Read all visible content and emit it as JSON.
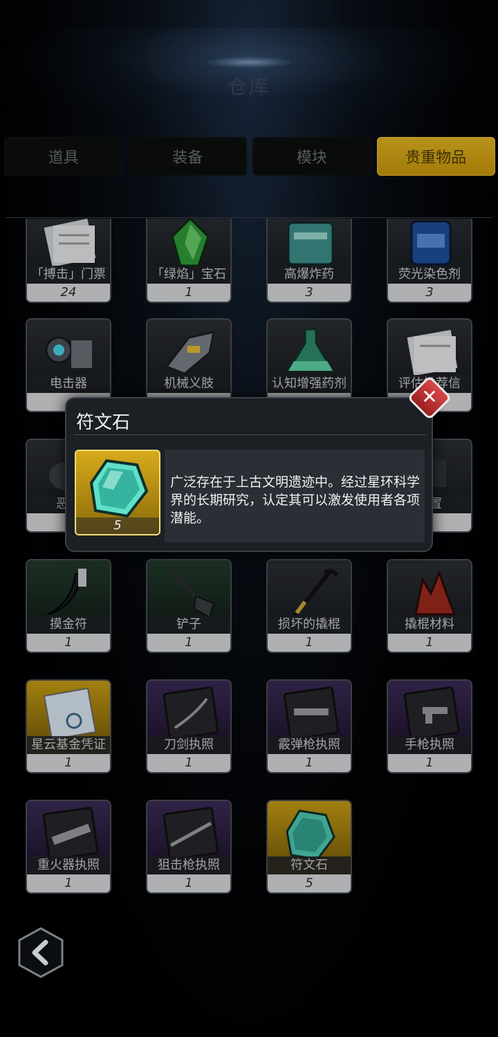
{
  "title": "仓库",
  "tabs": [
    {
      "label": "道具",
      "active": false
    },
    {
      "label": "装备",
      "active": false
    },
    {
      "label": "模块",
      "active": false
    },
    {
      "label": "贵重物品",
      "active": true
    }
  ],
  "items": [
    {
      "name": "「搏击」门票",
      "count": "24",
      "tone": "gray",
      "icon": "ticket-icon"
    },
    {
      "name": "「绿焰」宝石",
      "count": "1",
      "tone": "gray",
      "icon": "green-gem-icon"
    },
    {
      "name": "高爆炸药",
      "count": "3",
      "tone": "gray",
      "icon": "explosive-icon"
    },
    {
      "name": "荧光染色剂",
      "count": "3",
      "tone": "gray",
      "icon": "dye-jar-icon"
    },
    {
      "name": "电击器",
      "count": "",
      "tone": "gray",
      "icon": "taser-icon"
    },
    {
      "name": "机械义肢",
      "count": "",
      "tone": "gray",
      "icon": "mech-arm-icon"
    },
    {
      "name": "认知增强药剂",
      "count": "",
      "tone": "gray",
      "icon": "potion-icon"
    },
    {
      "name": "评估推荐信",
      "count": "",
      "tone": "gray",
      "icon": "letter-icon"
    },
    {
      "name": "恶魔",
      "count": "",
      "tone": "gray",
      "icon": "demon-icon"
    },
    {
      "name": "",
      "count": "",
      "tone": "gray",
      "icon": "blank-icon"
    },
    {
      "name": "",
      "count": "",
      "tone": "gray",
      "icon": "blank-icon"
    },
    {
      "name": "装置",
      "count": "",
      "tone": "gray",
      "icon": "device-icon"
    },
    {
      "name": "摸金符",
      "count": "1",
      "tone": "green",
      "icon": "claw-amulet-icon"
    },
    {
      "name": "铲子",
      "count": "1",
      "tone": "green",
      "icon": "shovel-icon"
    },
    {
      "name": "损坏的撬棍",
      "count": "1",
      "tone": "gray",
      "icon": "crowbar-icon"
    },
    {
      "name": "撬棍材料",
      "count": "1",
      "tone": "gray",
      "icon": "crystal-icon"
    },
    {
      "name": "星云基金凭证",
      "count": "1",
      "tone": "gold",
      "icon": "certificate-icon"
    },
    {
      "name": "刀剑执照",
      "count": "1",
      "tone": "purple",
      "icon": "sword-license-icon"
    },
    {
      "name": "霰弹枪执照",
      "count": "1",
      "tone": "purple",
      "icon": "shotgun-license-icon"
    },
    {
      "name": "手枪执照",
      "count": "1",
      "tone": "purple",
      "icon": "pistol-license-icon"
    },
    {
      "name": "重火器执照",
      "count": "1",
      "tone": "purple",
      "icon": "heavy-weapon-license-icon"
    },
    {
      "name": "狙击枪执照",
      "count": "1",
      "tone": "purple",
      "icon": "sniper-license-icon"
    },
    {
      "name": "符文石",
      "count": "5",
      "tone": "gold",
      "icon": "rune-stone-icon"
    }
  ],
  "modal": {
    "title": "符文石",
    "count": "5",
    "description": "广泛存在于上古文明遗迹中。经过星环科学界的长期研究，认定其可以激发使用者各项潜能。",
    "close_icon": "close-icon"
  },
  "back_icon": "back-chevron-icon"
}
